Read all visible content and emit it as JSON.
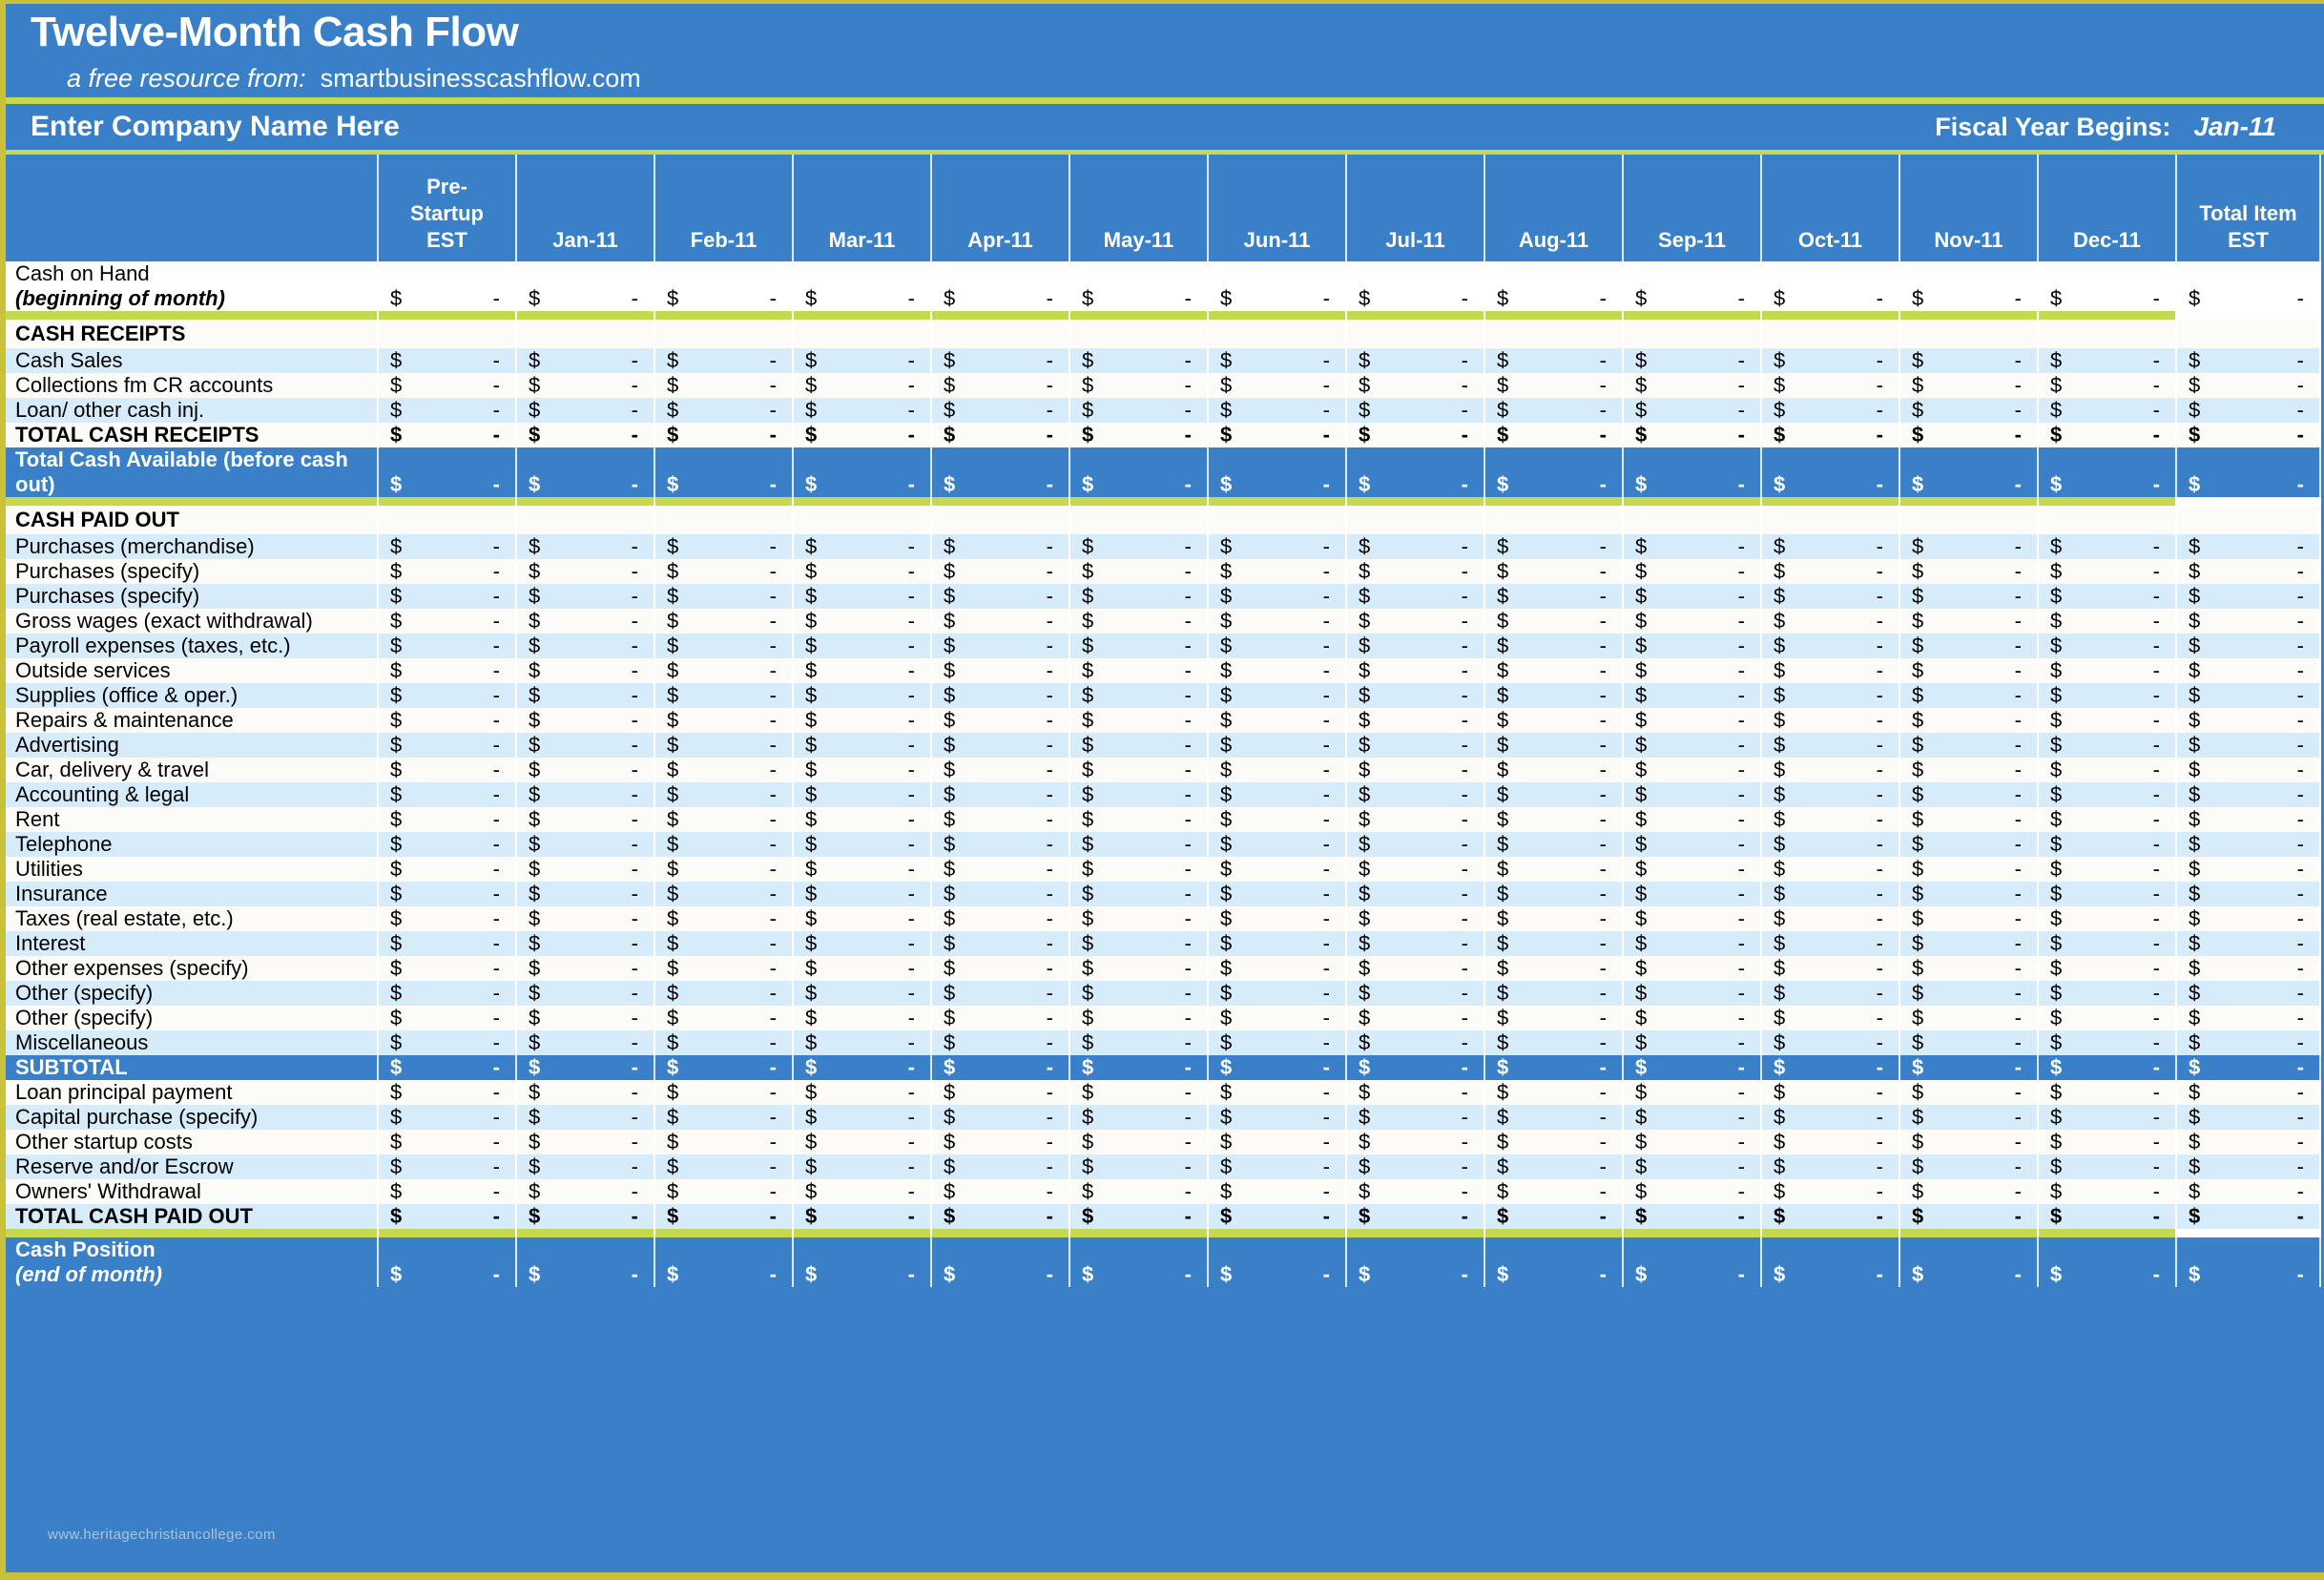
{
  "header": {
    "title": "Twelve-Month Cash Flow",
    "subtitle_prefix": "a free resource from:",
    "subtitle_site": "smartbusinesscashflow.com",
    "company_name": "Enter Company Name Here",
    "fiscal_label": "Fiscal Year Begins:",
    "fiscal_value": "Jan-11"
  },
  "watermark": "www.heritagechristiancollege.com",
  "colors": {
    "brand_blue": "#3a80c8",
    "accent_green": "#c4d94e",
    "border_olive": "#c9c13a",
    "row_light_blue": "#d7ecfa",
    "row_white": "#fcfbf7"
  },
  "columns": [
    {
      "id": "prestartup",
      "line1": "Pre-",
      "line2": "Startup",
      "line3": "EST"
    },
    {
      "id": "jan",
      "line1": "",
      "line2": "",
      "line3": "Jan-11"
    },
    {
      "id": "feb",
      "line1": "",
      "line2": "",
      "line3": "Feb-11"
    },
    {
      "id": "mar",
      "line1": "",
      "line2": "",
      "line3": "Mar-11"
    },
    {
      "id": "apr",
      "line1": "",
      "line2": "",
      "line3": "Apr-11"
    },
    {
      "id": "may",
      "line1": "",
      "line2": "",
      "line3": "May-11"
    },
    {
      "id": "jun",
      "line1": "",
      "line2": "",
      "line3": "Jun-11"
    },
    {
      "id": "jul",
      "line1": "",
      "line2": "",
      "line3": "Jul-11"
    },
    {
      "id": "aug",
      "line1": "",
      "line2": "",
      "line3": "Aug-11"
    },
    {
      "id": "sep",
      "line1": "",
      "line2": "",
      "line3": "Sep-11"
    },
    {
      "id": "oct",
      "line1": "",
      "line2": "",
      "line3": "Oct-11"
    },
    {
      "id": "nov",
      "line1": "",
      "line2": "",
      "line3": "Nov-11"
    },
    {
      "id": "dec",
      "line1": "",
      "line2": "",
      "line3": "Dec-11"
    },
    {
      "id": "total",
      "line1": "",
      "line2": "Total Item",
      "line3": "EST"
    }
  ],
  "currency_symbol": "$",
  "empty_value": "-",
  "rows": [
    {
      "key": "cash_on_hand",
      "label_line1": "Cash on Hand",
      "label_line2": "(beginning of month)",
      "style": "white-two",
      "money": true
    },
    {
      "key": "rule_1",
      "style": "rule-green"
    },
    {
      "key": "cash_receipts_header",
      "label": "CASH RECEIPTS",
      "style": "section",
      "money": false
    },
    {
      "key": "cash_sales",
      "label": "Cash Sales",
      "style": "z1",
      "money": true
    },
    {
      "key": "collections_cr",
      "label": "Collections fm CR accounts",
      "style": "z0",
      "money": true
    },
    {
      "key": "loan_other_cash_inj",
      "label": "Loan/ other cash inj.",
      "style": "z1",
      "money": true
    },
    {
      "key": "total_cash_receipts",
      "label": "TOTAL CASH RECEIPTS",
      "style": "z0-bold",
      "money": true
    },
    {
      "key": "total_cash_available",
      "label_line1": "Total Cash Available (before cash",
      "label_line2": "out)",
      "style": "blue-two",
      "money": true
    },
    {
      "key": "rule_2",
      "style": "rule-green"
    },
    {
      "key": "cash_paid_out_header",
      "label": "CASH PAID OUT",
      "style": "section",
      "money": false
    },
    {
      "key": "purchases_merchandise",
      "label": "Purchases (merchandise)",
      "style": "z1",
      "money": true
    },
    {
      "key": "purchases_specify_1",
      "label": "Purchases (specify)",
      "style": "z0",
      "money": true
    },
    {
      "key": "purchases_specify_2",
      "label": "Purchases (specify)",
      "style": "z1",
      "money": true
    },
    {
      "key": "gross_wages",
      "label": "Gross wages (exact withdrawal)",
      "style": "z0",
      "money": true
    },
    {
      "key": "payroll_expenses",
      "label": "Payroll expenses (taxes, etc.)",
      "style": "z1",
      "money": true
    },
    {
      "key": "outside_services",
      "label": "Outside services",
      "style": "z0",
      "money": true
    },
    {
      "key": "supplies",
      "label": "Supplies (office & oper.)",
      "style": "z1",
      "money": true
    },
    {
      "key": "repairs_maintenance",
      "label": "Repairs & maintenance",
      "style": "z0",
      "money": true
    },
    {
      "key": "advertising",
      "label": "Advertising",
      "style": "z1",
      "money": true
    },
    {
      "key": "car_delivery_travel",
      "label": "Car, delivery & travel",
      "style": "z0",
      "money": true
    },
    {
      "key": "accounting_legal",
      "label": "Accounting & legal",
      "style": "z1",
      "money": true
    },
    {
      "key": "rent",
      "label": "Rent",
      "style": "z0",
      "money": true
    },
    {
      "key": "telephone",
      "label": "Telephone",
      "style": "z1",
      "money": true
    },
    {
      "key": "utilities",
      "label": "Utilities",
      "style": "z0",
      "money": true
    },
    {
      "key": "insurance",
      "label": "Insurance",
      "style": "z1",
      "money": true
    },
    {
      "key": "taxes_real_estate",
      "label": "Taxes (real estate, etc.)",
      "style": "z0",
      "money": true
    },
    {
      "key": "interest",
      "label": "Interest",
      "style": "z1",
      "money": true
    },
    {
      "key": "other_expenses_specify",
      "label": "Other expenses (specify)",
      "style": "z0",
      "money": true
    },
    {
      "key": "other_specify_1",
      "label": "Other (specify)",
      "style": "z1",
      "money": true
    },
    {
      "key": "other_specify_2",
      "label": "Other (specify)",
      "style": "z0",
      "money": true
    },
    {
      "key": "miscellaneous",
      "label": "Miscellaneous",
      "style": "z1",
      "money": true
    },
    {
      "key": "subtotal",
      "label": "SUBTOTAL",
      "style": "blue",
      "money": true
    },
    {
      "key": "loan_principal_payment",
      "label": "Loan principal payment",
      "style": "z0",
      "money": true
    },
    {
      "key": "capital_purchase",
      "label": "Capital purchase (specify)",
      "style": "z1",
      "money": true
    },
    {
      "key": "other_startup_costs",
      "label": "Other startup costs",
      "style": "z0",
      "money": true
    },
    {
      "key": "reserve_escrow",
      "label": "Reserve and/or Escrow",
      "style": "z1",
      "money": true
    },
    {
      "key": "owners_withdrawal",
      "label": "Owners' Withdrawal",
      "style": "z0",
      "money": true
    },
    {
      "key": "total_cash_paid_out",
      "label": "TOTAL CASH PAID OUT",
      "style": "z1-bold",
      "money": true
    },
    {
      "key": "rule_3",
      "style": "rule-green"
    },
    {
      "key": "cash_position",
      "label_line1": "Cash Position",
      "label_line2": "(end of month)",
      "style": "blue-two",
      "money": true
    }
  ]
}
